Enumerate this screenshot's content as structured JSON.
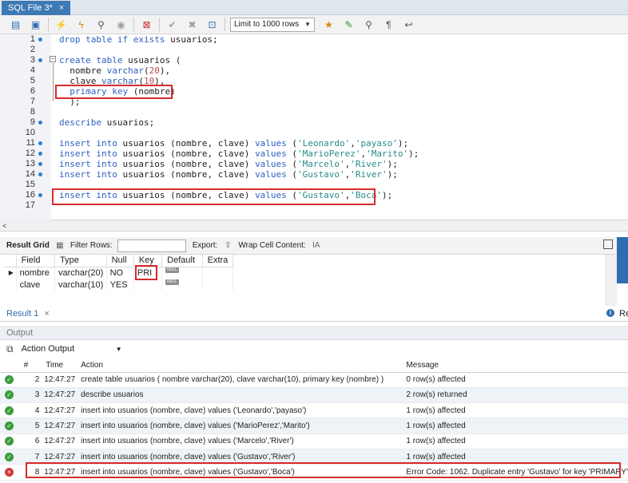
{
  "tab": {
    "title": "SQL File 3*",
    "close": "×"
  },
  "toolbar": {
    "limit_label": "Limit to 1000 rows"
  },
  "editor": {
    "lines": [
      {
        "n": "1",
        "dot": true,
        "tokens": [
          [
            "kw",
            "drop table if exists "
          ],
          [
            "",
            "usuarios;"
          ]
        ]
      },
      {
        "n": "2",
        "dot": false,
        "tokens": []
      },
      {
        "n": "3",
        "dot": true,
        "tokens": [
          [
            "kw",
            "create table "
          ],
          [
            "",
            "usuarios ("
          ]
        ]
      },
      {
        "n": "4",
        "dot": false,
        "tokens": [
          [
            "",
            "  nombre "
          ],
          [
            "kw",
            "varchar"
          ],
          [
            "",
            "("
          ],
          [
            "num",
            "20"
          ],
          [
            "",
            "),"
          ]
        ]
      },
      {
        "n": "5",
        "dot": false,
        "tokens": [
          [
            "",
            "  clave "
          ],
          [
            "kw",
            "varchar"
          ],
          [
            "",
            "("
          ],
          [
            "num",
            "10"
          ],
          [
            "",
            "),"
          ]
        ]
      },
      {
        "n": "6",
        "dot": false,
        "tokens": [
          [
            "kw",
            "  primary key "
          ],
          [
            "",
            "(nombre)"
          ]
        ]
      },
      {
        "n": "7",
        "dot": false,
        "tokens": [
          [
            "",
            "  );"
          ]
        ]
      },
      {
        "n": "8",
        "dot": false,
        "tokens": []
      },
      {
        "n": "9",
        "dot": true,
        "tokens": [
          [
            "kw",
            "describe "
          ],
          [
            "",
            "usuarios;"
          ]
        ]
      },
      {
        "n": "10",
        "dot": false,
        "tokens": []
      },
      {
        "n": "11",
        "dot": true,
        "tokens": [
          [
            "kw",
            "insert into "
          ],
          [
            "",
            "usuarios (nombre, clave) "
          ],
          [
            "kw",
            "values "
          ],
          [
            "",
            "("
          ],
          [
            "str",
            "'Leonardo'"
          ],
          [
            "",
            ","
          ],
          [
            "str",
            "'payaso'"
          ],
          [
            "",
            ");"
          ]
        ]
      },
      {
        "n": "12",
        "dot": true,
        "tokens": [
          [
            "kw",
            "insert into "
          ],
          [
            "",
            "usuarios (nombre, clave) "
          ],
          [
            "kw",
            "values "
          ],
          [
            "",
            "("
          ],
          [
            "str",
            "'MarioPerez'"
          ],
          [
            "",
            ","
          ],
          [
            "str",
            "'Marito'"
          ],
          [
            "",
            ");"
          ]
        ]
      },
      {
        "n": "13",
        "dot": true,
        "tokens": [
          [
            "kw",
            "insert into "
          ],
          [
            "",
            "usuarios (nombre, clave) "
          ],
          [
            "kw",
            "values "
          ],
          [
            "",
            "("
          ],
          [
            "str",
            "'Marcelo'"
          ],
          [
            "",
            ","
          ],
          [
            "str",
            "'River'"
          ],
          [
            "",
            ");"
          ]
        ]
      },
      {
        "n": "14",
        "dot": true,
        "tokens": [
          [
            "kw",
            "insert into "
          ],
          [
            "",
            "usuarios (nombre, clave) "
          ],
          [
            "kw",
            "values "
          ],
          [
            "",
            "("
          ],
          [
            "str",
            "'Gustavo'"
          ],
          [
            "",
            ","
          ],
          [
            "str",
            "'River'"
          ],
          [
            "",
            ");"
          ]
        ]
      },
      {
        "n": "15",
        "dot": false,
        "tokens": []
      },
      {
        "n": "16",
        "dot": true,
        "tokens": [
          [
            "kw",
            "insert into "
          ],
          [
            "",
            "usuarios (nombre, clave) "
          ],
          [
            "kw",
            "values "
          ],
          [
            "",
            "("
          ],
          [
            "str",
            "'Gustavo'"
          ],
          [
            "",
            ","
          ],
          [
            "str",
            "'Boca'"
          ],
          [
            "",
            ");"
          ]
        ]
      },
      {
        "n": "17",
        "dot": false,
        "tokens": []
      }
    ]
  },
  "scroll_left_arrow": "<",
  "result_toolbar": {
    "result_grid": "Result Grid",
    "filter_rows": "Filter Rows:",
    "export": "Export:",
    "wrap": "Wrap Cell Content:",
    "wrap_icon": "IA"
  },
  "grid": {
    "headers": [
      "",
      "Field",
      "Type",
      "Null",
      "Key",
      "Default",
      "Extra"
    ],
    "null_badge": "NULL",
    "current_row_marker": "▶",
    "rows": [
      {
        "field": "nombre",
        "type": "varchar(20)",
        "null": "NO",
        "key": "PRI",
        "default_null": true,
        "extra": ""
      },
      {
        "field": "clave",
        "type": "varchar(10)",
        "null": "YES",
        "key": "",
        "default_null": true,
        "extra": ""
      }
    ]
  },
  "result_tabs": {
    "result1": "Result 1",
    "close": "×",
    "info": "i",
    "right_label": "Re"
  },
  "output": {
    "header": "Output",
    "selector": "Action Output",
    "columns": [
      "",
      "#",
      "Time",
      "Action",
      "Message"
    ],
    "rows": [
      {
        "status": "ok",
        "n": "2",
        "time": "12:47:27",
        "action": "create table usuarios (  nombre varchar(20),  clave varchar(10),  primary key (nombre)  )",
        "message": "0 row(s) affected"
      },
      {
        "status": "ok",
        "n": "3",
        "time": "12:47:27",
        "action": "describe usuarios",
        "message": "2 row(s) returned"
      },
      {
        "status": "ok",
        "n": "4",
        "time": "12:47:27",
        "action": "insert into usuarios (nombre, clave) values ('Leonardo','payaso')",
        "message": "1 row(s) affected"
      },
      {
        "status": "ok",
        "n": "5",
        "time": "12:47:27",
        "action": "insert into usuarios (nombre, clave) values ('MarioPerez','Marito')",
        "message": "1 row(s) affected"
      },
      {
        "status": "ok",
        "n": "6",
        "time": "12:47:27",
        "action": "insert into usuarios (nombre, clave) values ('Marcelo','River')",
        "message": "1 row(s) affected"
      },
      {
        "status": "ok",
        "n": "7",
        "time": "12:47:27",
        "action": "insert into usuarios (nombre, clave) values ('Gustavo','River')",
        "message": "1 row(s) affected"
      },
      {
        "status": "err",
        "n": "8",
        "time": "12:47:27",
        "action": "insert into usuarios (nombre, clave) values ('Gustavo','Boca')",
        "message": "Error Code: 1062. Duplicate entry 'Gustavo' for key 'PRIMARY'"
      }
    ]
  },
  "colors": {
    "accent": "#2e6db0",
    "highlight": "#d62b2b",
    "ok": "#3a9b3a",
    "error": "#d23a3a"
  }
}
